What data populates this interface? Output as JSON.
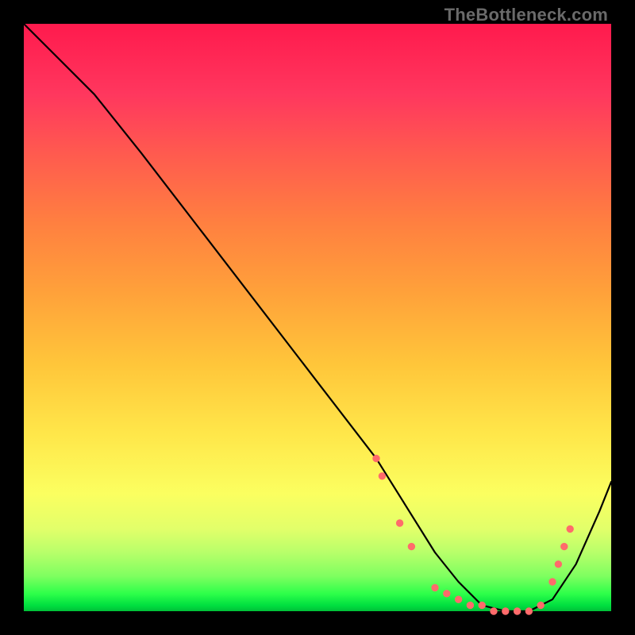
{
  "watermark": "TheBottleneck.com",
  "colors": {
    "frame": "#000000",
    "watermark_text": "#6a6a6a",
    "curve": "#000000",
    "dots": "#ff6b6b"
  },
  "chart_data": {
    "type": "line",
    "title": "",
    "xlabel": "",
    "ylabel": "",
    "xlim": [
      0,
      100
    ],
    "ylim": [
      0,
      100
    ],
    "grid": false,
    "legend": false,
    "gradient_background": {
      "orientation": "vertical",
      "stops": [
        {
          "pos": 0.0,
          "color": "#ff1a4d"
        },
        {
          "pos": 0.5,
          "color": "#ffc63a"
        },
        {
          "pos": 0.8,
          "color": "#fbff60"
        },
        {
          "pos": 1.0,
          "color": "#00c038"
        }
      ]
    },
    "series": [
      {
        "name": "bottleneck-curve",
        "x": [
          0,
          6,
          12,
          20,
          30,
          40,
          50,
          60,
          65,
          70,
          74,
          78,
          82,
          86,
          90,
          94,
          98,
          100
        ],
        "y": [
          100,
          94,
          88,
          78,
          65,
          52,
          39,
          26,
          18,
          10,
          5,
          1,
          0,
          0,
          2,
          8,
          17,
          22
        ]
      }
    ],
    "marker_clusters": [
      {
        "name": "left-rise-dots",
        "points": [
          {
            "x": 60,
            "y": 26
          },
          {
            "x": 61,
            "y": 23
          },
          {
            "x": 64,
            "y": 15
          },
          {
            "x": 66,
            "y": 11
          }
        ]
      },
      {
        "name": "valley-floor-dots",
        "points": [
          {
            "x": 70,
            "y": 4
          },
          {
            "x": 72,
            "y": 3
          },
          {
            "x": 74,
            "y": 2
          },
          {
            "x": 76,
            "y": 1
          },
          {
            "x": 78,
            "y": 1
          },
          {
            "x": 80,
            "y": 0
          },
          {
            "x": 82,
            "y": 0
          },
          {
            "x": 84,
            "y": 0
          },
          {
            "x": 86,
            "y": 0
          },
          {
            "x": 88,
            "y": 1
          }
        ]
      },
      {
        "name": "right-rise-dots",
        "points": [
          {
            "x": 90,
            "y": 5
          },
          {
            "x": 91,
            "y": 8
          },
          {
            "x": 92,
            "y": 11
          },
          {
            "x": 93,
            "y": 14
          }
        ]
      }
    ]
  }
}
